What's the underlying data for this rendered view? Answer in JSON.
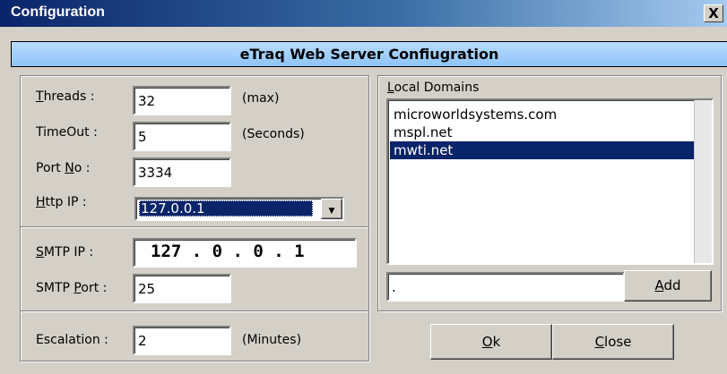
{
  "window": {
    "title": "Configuration",
    "close_glyph": "X"
  },
  "header": {
    "title": "eTraq  Web Server Confiugration"
  },
  "threads": {
    "label_mnemonic": "T",
    "label_rest": "hreads :",
    "value": "32",
    "unit": "(max)"
  },
  "timeout": {
    "label": "TimeOut :",
    "value": "5",
    "unit": "(Seconds)"
  },
  "port": {
    "label_pre": "Port ",
    "label_mnemonic": "N",
    "label_post": "o :",
    "value": "3334"
  },
  "http_ip": {
    "label_mnemonic": "H",
    "label_rest": "ttp  IP :",
    "selected": "127.0.0.1"
  },
  "smtp_ip": {
    "label_mnemonic": "S",
    "label_rest": "MTP IP :",
    "value": "127 .  0  .  0  .  1"
  },
  "smtp_port": {
    "label_pre": "SMTP ",
    "label_mnemonic": "P",
    "label_post": "ort :",
    "value": "25"
  },
  "escalation": {
    "label": "Escalation :",
    "value": "2",
    "unit": "(Minutes)"
  },
  "domains": {
    "label_mnemonic": "L",
    "label_rest": "ocal Domains",
    "items": [
      "microworldsystems.com",
      "mspl.net",
      "mwti.net"
    ],
    "selected_index": 2,
    "input_value": ".",
    "add_mnemonic": "A",
    "add_rest": "dd"
  },
  "buttons": {
    "ok_mnemonic": "O",
    "ok_rest": "k",
    "close_mnemonic": "C",
    "close_rest": "lose"
  }
}
